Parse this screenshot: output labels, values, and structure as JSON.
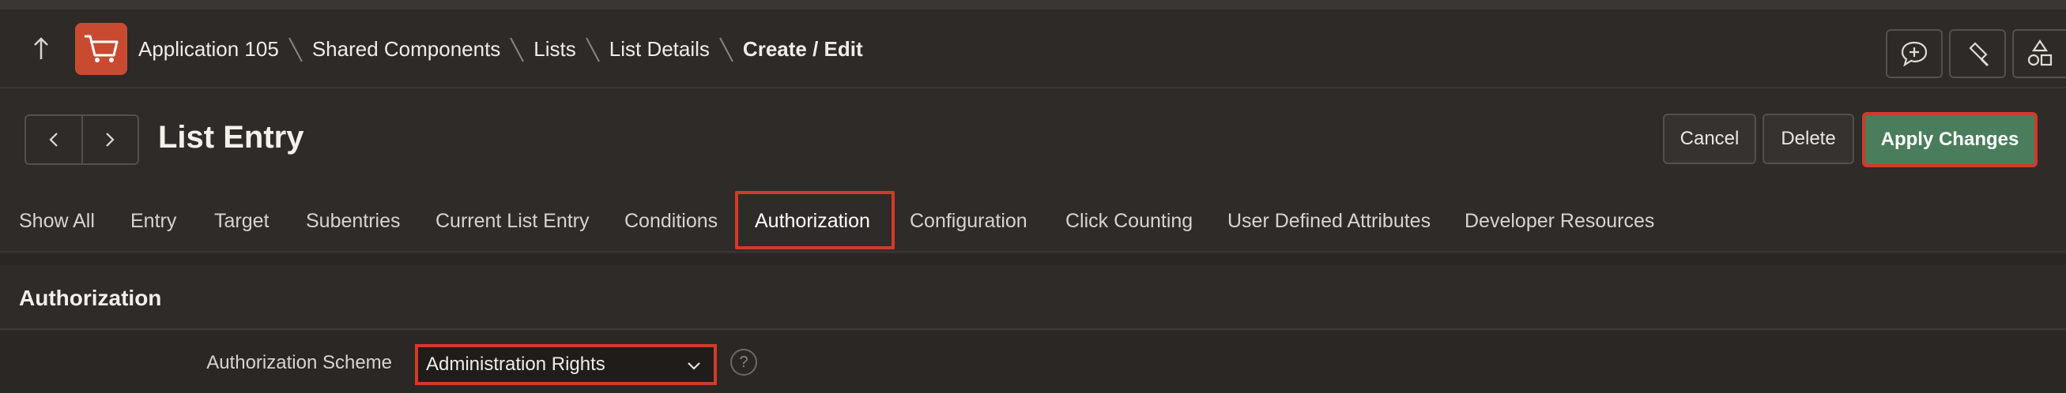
{
  "breadcrumb": {
    "items": [
      "Application 105",
      "Shared Components",
      "Lists",
      "List Details"
    ],
    "current": "Create / Edit"
  },
  "page": {
    "title": "List Entry"
  },
  "actions": {
    "cancel": "Cancel",
    "delete": "Delete",
    "apply": "Apply Changes"
  },
  "tabs": [
    {
      "label": "Show All"
    },
    {
      "label": "Entry"
    },
    {
      "label": "Target"
    },
    {
      "label": "Subentries"
    },
    {
      "label": "Current List Entry"
    },
    {
      "label": "Conditions"
    },
    {
      "label": "Authorization",
      "active": true
    },
    {
      "label": "Configuration"
    },
    {
      "label": "Click Counting"
    },
    {
      "label": "User Defined Attributes"
    },
    {
      "label": "Developer Resources"
    }
  ],
  "section": {
    "title": "Authorization",
    "field": {
      "label": "Authorization Scheme",
      "value": "Administration Rights",
      "help": "?"
    }
  },
  "icons": {
    "up": "arrow-up-icon",
    "logo": "shopping-cart-icon",
    "header_buttons": [
      "comment-add-icon",
      "brush-icon",
      "shapes-icon"
    ],
    "prev": "chevron-left-icon",
    "next": "chevron-right-icon"
  },
  "colors": {
    "accent_highlight": "#d23a2a",
    "primary_button": "#4a7d5b",
    "logo_bg": "#c84b31"
  }
}
